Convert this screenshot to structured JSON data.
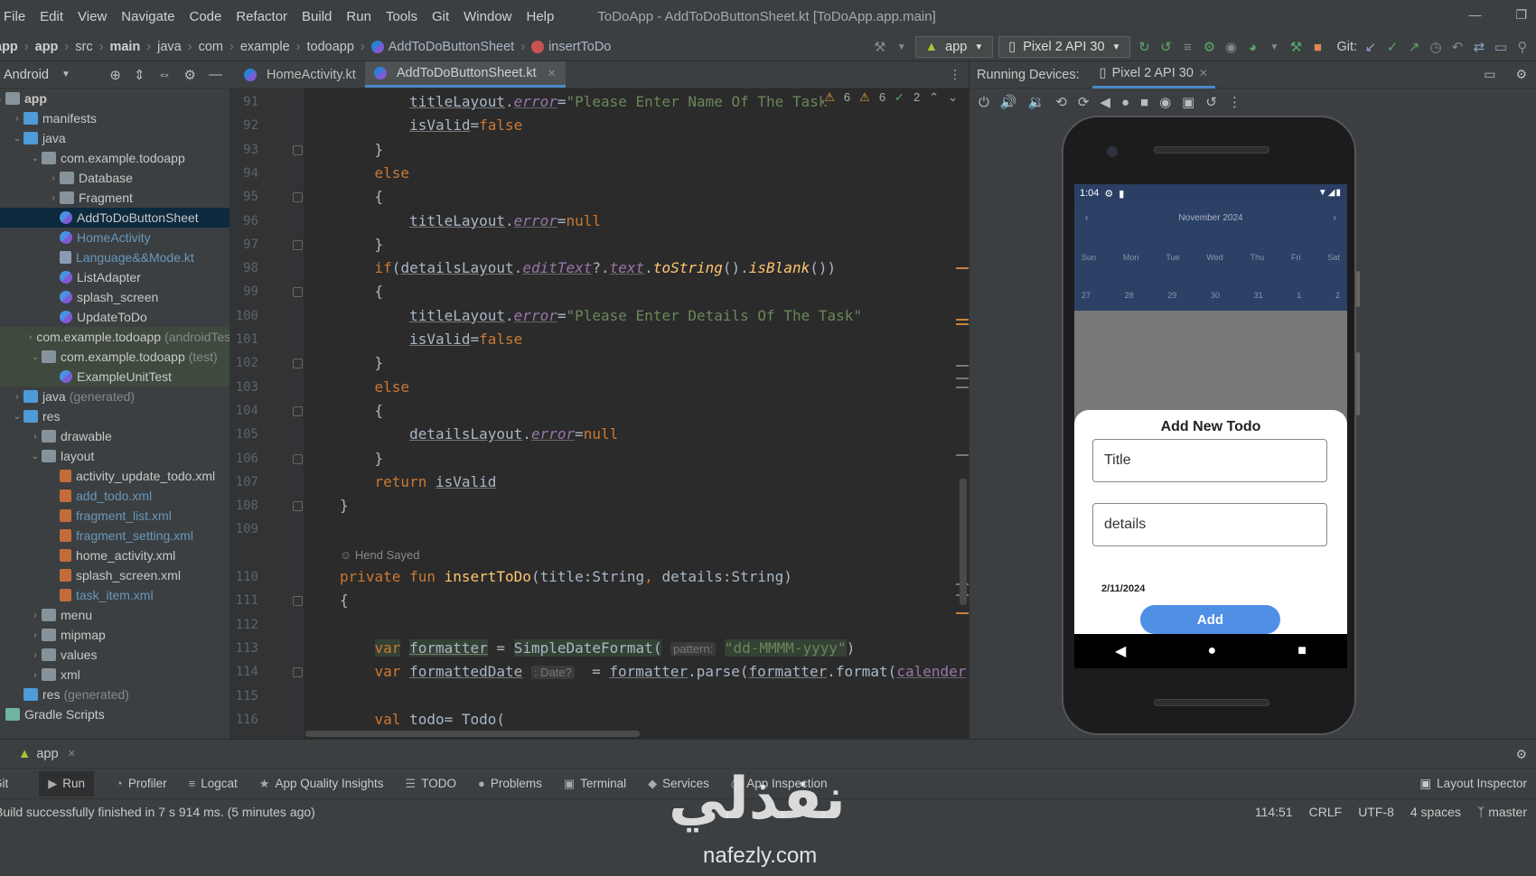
{
  "menubar": {
    "items": [
      "File",
      "Edit",
      "View",
      "Navigate",
      "Code",
      "Refactor",
      "Build",
      "Run",
      "Tools",
      "Git",
      "Window",
      "Help"
    ],
    "window_title": "ToDoApp - AddToDoButtonSheet.kt [ToDoApp.app.main]"
  },
  "navbar": {
    "crumbs": [
      "app",
      "app",
      "src",
      "main",
      "java",
      "com",
      "example",
      "todoapp",
      "AddToDoButtonSheet",
      "insertToDo"
    ],
    "run_config": "app",
    "device": "Pixel 2 API 30",
    "git_label": "Git:"
  },
  "project_panel": {
    "view_mode": "Android",
    "tree": [
      {
        "label": "app",
        "depth": 0,
        "icon": "folder",
        "expanded": true,
        "bold": true
      },
      {
        "label": "manifests",
        "depth": 1,
        "icon": "folder",
        "expanded": false
      },
      {
        "label": "java",
        "depth": 1,
        "icon": "folder",
        "expanded": true
      },
      {
        "label": "com.example.todoapp",
        "depth": 2,
        "icon": "folder",
        "expanded": true
      },
      {
        "label": "Database",
        "depth": 3,
        "icon": "folder",
        "expanded": false
      },
      {
        "label": "Fragment",
        "depth": 3,
        "icon": "folder",
        "expanded": false
      },
      {
        "label": "AddToDoButtonSheet",
        "depth": 3,
        "icon": "kt",
        "selected": true
      },
      {
        "label": "HomeActivity",
        "depth": 3,
        "icon": "kt",
        "color": "blue"
      },
      {
        "label": "Language&&Mode.kt",
        "depth": 3,
        "icon": "file",
        "color": "blue"
      },
      {
        "label": "ListAdapter",
        "depth": 3,
        "icon": "kt"
      },
      {
        "label": "splash_screen",
        "depth": 3,
        "icon": "kt"
      },
      {
        "label": "UpdateToDo",
        "depth": 3,
        "icon": "kt"
      },
      {
        "label": "com.example.todoapp",
        "suffix": "(androidTest)",
        "depth": 2,
        "icon": "folder",
        "expanded": false,
        "test": true
      },
      {
        "label": "com.example.todoapp",
        "suffix": "(test)",
        "depth": 2,
        "icon": "folder",
        "expanded": true,
        "test": true
      },
      {
        "label": "ExampleUnitTest",
        "depth": 3,
        "icon": "kt",
        "test": true
      },
      {
        "label": "java",
        "suffix": "(generated)",
        "depth": 1,
        "icon": "folder",
        "expanded": false
      },
      {
        "label": "res",
        "depth": 1,
        "icon": "folder",
        "expanded": true
      },
      {
        "label": "drawable",
        "depth": 2,
        "icon": "folder",
        "expanded": false
      },
      {
        "label": "layout",
        "depth": 2,
        "icon": "folder",
        "expanded": true
      },
      {
        "label": "activity_update_todo.xml",
        "depth": 3,
        "icon": "xml"
      },
      {
        "label": "add_todo.xml",
        "depth": 3,
        "icon": "xml",
        "color": "blue"
      },
      {
        "label": "fragment_list.xml",
        "depth": 3,
        "icon": "xml",
        "color": "blue"
      },
      {
        "label": "fragment_setting.xml",
        "depth": 3,
        "icon": "xml",
        "color": "blue"
      },
      {
        "label": "home_activity.xml",
        "depth": 3,
        "icon": "xml"
      },
      {
        "label": "splash_screen.xml",
        "depth": 3,
        "icon": "xml"
      },
      {
        "label": "task_item.xml",
        "depth": 3,
        "icon": "xml",
        "color": "blue"
      },
      {
        "label": "menu",
        "depth": 2,
        "icon": "folder",
        "expanded": false
      },
      {
        "label": "mipmap",
        "depth": 2,
        "icon": "folder",
        "expanded": false
      },
      {
        "label": "values",
        "depth": 2,
        "icon": "folder",
        "expanded": false
      },
      {
        "label": "xml",
        "depth": 2,
        "icon": "folder",
        "expanded": false
      },
      {
        "label": "res",
        "suffix": "(generated)",
        "depth": 1,
        "icon": "folder",
        "noarrow": true
      },
      {
        "label": "Gradle Scripts",
        "depth": 0,
        "icon": "gradle",
        "expanded": false
      }
    ]
  },
  "editor": {
    "tabs": [
      {
        "label": "HomeActivity.kt",
        "active": false
      },
      {
        "label": "AddToDoButtonSheet.kt",
        "active": true
      }
    ],
    "inspections": {
      "warnings": "6",
      "weak_warnings": "6",
      "typos": "2"
    },
    "author": "Hend Sayed",
    "lines": [
      {
        "n": "91",
        "html": "        <span class=\"var\">titleLayout</span>.<span class=\"prop\">error</span>=<span class=\"str\">\"Please Enter Name Of The Task\"</span>"
      },
      {
        "n": "92",
        "html": "        <span class=\"var\">isValid</span>=<span class=\"kw\">false</span>"
      },
      {
        "n": "93",
        "html": "    }"
      },
      {
        "n": "94",
        "html": "    <span class=\"kw\">else</span>"
      },
      {
        "n": "95",
        "html": "    {"
      },
      {
        "n": "96",
        "html": "        <span class=\"var\">titleLayout</span>.<span class=\"prop\">error</span>=<span class=\"kw\">null</span>"
      },
      {
        "n": "97",
        "html": "    }"
      },
      {
        "n": "98",
        "html": "    <span class=\"kw\">if</span>(<span class=\"var\">detailsLayout</span>.<span class=\"prop\">editText</span>?.<span class=\"prop\">text</span>.<span class=\"fni\">toString</span>().<span class=\"fni\">isBlank</span>())"
      },
      {
        "n": "99",
        "html": "    {"
      },
      {
        "n": "100",
        "html": "        <span class=\"var\">titleLayout</span>.<span class=\"prop\">error</span>=<span class=\"str\">\"Please Enter Details Of The Task\"</span>"
      },
      {
        "n": "101",
        "html": "        <span class=\"var\">isValid</span>=<span class=\"kw\">false</span>"
      },
      {
        "n": "102",
        "html": "    }"
      },
      {
        "n": "103",
        "html": "    <span class=\"kw\">else</span>"
      },
      {
        "n": "104",
        "html": "    {"
      },
      {
        "n": "105",
        "html": "        <span class=\"var\">detailsLayout</span>.<span class=\"prop\">error</span>=<span class=\"kw\">null</span>"
      },
      {
        "n": "106",
        "html": "    }"
      },
      {
        "n": "107",
        "html": "    <span class=\"kw\">return</span> <span class=\"var\">isValid</span>"
      },
      {
        "n": "108",
        "html": "}"
      },
      {
        "n": "109",
        "html": ""
      },
      {
        "n": "",
        "author": true
      },
      {
        "n": "110",
        "html": "<span class=\"kw\">private fun</span> <span class=\"fn\">insertToDo</span>(title:String<span class=\"kw\">,</span> details:String)"
      },
      {
        "n": "111",
        "html": "{"
      },
      {
        "n": "112",
        "html": ""
      },
      {
        "n": "113",
        "html": "    <span class=\"kw hlbg\">var</span> <span class=\"var hlbg\">formatter</span> = <span class=\"hlbg\">SimpleDateFormat(</span> <span class=\"hint\">pattern:</span> <span class=\"str hlbg\">\"dd-MMMM-yyyy\"</span>)"
      },
      {
        "n": "114",
        "html": "    <span class=\"kw\">var</span> <span class=\"var\">formattedDate</span> <span class=\"hint\">: Date?</span>  = <span class=\"var\">formatter</span>.parse(<span class=\"var\">formatter</span>.format(<span class=\"prop\" style=\"font-style:normal;color:#9876aa\">calender</span>."
      },
      {
        "n": "115",
        "html": ""
      },
      {
        "n": "116",
        "html": "    <span class=\"kw\">val</span> todo= Todo("
      }
    ]
  },
  "devices": {
    "header": "Running Devices:",
    "tab": "Pixel 2 API 30",
    "phone": {
      "time": "1:04",
      "calendar_month": "November 2024",
      "weekdays": [
        "Sun",
        "Mon",
        "Tue",
        "Wed",
        "Thu",
        "Fri",
        "Sat"
      ],
      "days": [
        "27",
        "28",
        "29",
        "30",
        "31",
        "1",
        "2"
      ],
      "sheet_title": "Add New Todo",
      "title_field": "Title",
      "details_field": "details",
      "date": "2/11/2024",
      "add_button": "Add"
    }
  },
  "bottom": {
    "run_tab": "app",
    "tool_windows": [
      "Git",
      "Run",
      "Profiler",
      "Logcat",
      "App Quality Insights",
      "TODO",
      "Problems",
      "Terminal",
      "Services",
      "App Inspection"
    ],
    "layout_inspector": "Layout Inspector",
    "status_message": "Build successfully finished in 7 s 914 ms. (5 minutes ago)",
    "position": "114:51",
    "line_sep": "CRLF",
    "encoding": "UTF-8",
    "indent": "4 spaces",
    "branch": "master"
  },
  "watermark": {
    "arabic": "نفذلي",
    "latin": "nafezly.com"
  }
}
